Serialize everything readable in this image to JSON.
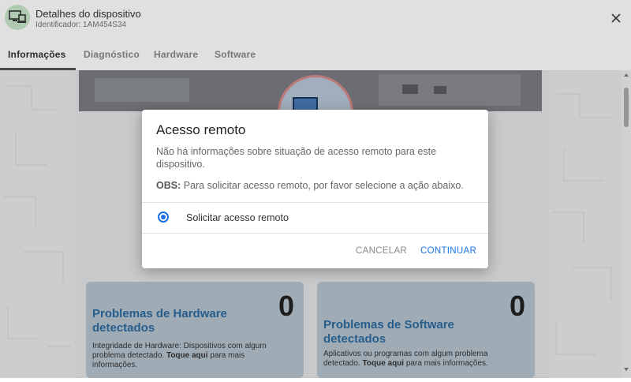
{
  "header": {
    "title": "Detalhes do dispositivo",
    "subtitle": "Identificador: 1AM454S34",
    "device_icon": "monitor-laptop-icon",
    "close_icon": "close-icon"
  },
  "tabs": [
    {
      "label": "Informações",
      "active": true
    },
    {
      "label": "Diagnóstico",
      "active": false
    },
    {
      "label": "Hardware",
      "active": false
    },
    {
      "label": "Software",
      "active": false
    }
  ],
  "cards": [
    {
      "title": "Problemas de Hardware detectados",
      "count": "0",
      "desc_prefix": "Integridade de Hardware: Dispositivos com algum problema detectado.",
      "desc_link": "Toque aqui",
      "desc_suffix": "para mais informações."
    },
    {
      "title": "Problemas de Software detectados",
      "count": "0",
      "desc_prefix": "Aplicativos ou programas com algum problema detectado.",
      "desc_link": "Toque aqui",
      "desc_suffix": "para mais informações."
    }
  ],
  "dialog": {
    "title": "Acesso remoto",
    "message": "Não há informações sobre situação de acesso remoto para este dispositivo.",
    "note_label": "OBS:",
    "note_text": "Para solicitar acesso remoto, por favor selecione a ação abaixo.",
    "option_label": "Solicitar acesso remoto",
    "option_selected": true,
    "cancel_label": "CANCELAR",
    "continue_label": "CONTINUAR"
  },
  "colors": {
    "accent": "#1a73e8",
    "card_title": "#2c6aa0",
    "avatar_bg": "#c8e6c9"
  }
}
